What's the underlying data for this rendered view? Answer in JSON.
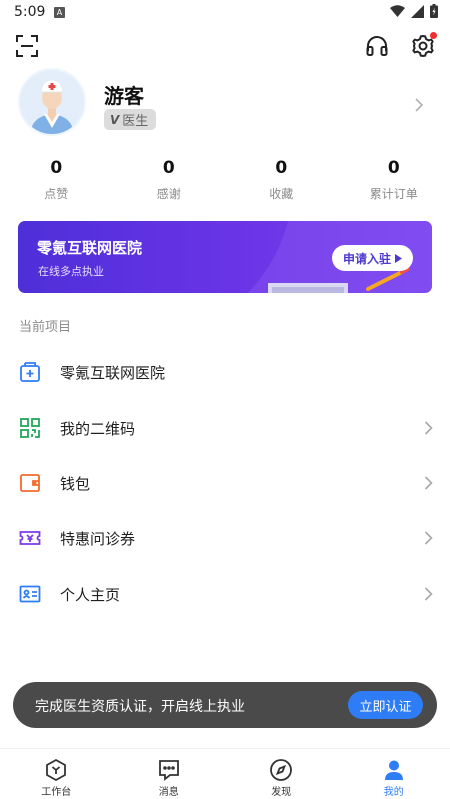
{
  "status_bar": {
    "time": "5:09",
    "notif_letter": "A"
  },
  "top_bar": {
    "icons": [
      "scan-icon",
      "headset-icon",
      "settings-icon"
    ],
    "settings_has_badge": true
  },
  "profile": {
    "name": "游客",
    "badge_mark": "V",
    "badge_text": "医生"
  },
  "stats": [
    {
      "value": "0",
      "label": "点赞"
    },
    {
      "value": "0",
      "label": "感谢"
    },
    {
      "value": "0",
      "label": "收藏"
    },
    {
      "value": "0",
      "label": "累计订单"
    }
  ],
  "banner": {
    "title": "零氪互联网医院",
    "subtitle": "在线多点执业",
    "button_label": "申请入驻"
  },
  "section": {
    "title": "当前项目"
  },
  "menu": [
    {
      "label": "零氪互联网医院",
      "icon": "hospital-icon",
      "chevron": false,
      "color": "#2f7df6"
    },
    {
      "label": "我的二维码",
      "icon": "qr-code-icon",
      "chevron": true,
      "color": "#22a85a"
    },
    {
      "label": "钱包",
      "icon": "wallet-icon",
      "chevron": true,
      "color": "#f36a2c"
    },
    {
      "label": "特惠问诊券",
      "icon": "coupon-icon",
      "chevron": true,
      "color": "#7b3be6"
    },
    {
      "label": "个人主页",
      "icon": "id-card-icon",
      "chevron": true,
      "color": "#2f7df6"
    }
  ],
  "toast": {
    "text": "完成医生资质认证，开启线上执业",
    "button_label": "立即认证"
  },
  "bottom_nav": [
    {
      "label": "工作台",
      "icon": "workbench-icon",
      "active": false
    },
    {
      "label": "消息",
      "icon": "message-icon",
      "active": false
    },
    {
      "label": "发现",
      "icon": "compass-icon",
      "active": false
    },
    {
      "label": "我的",
      "icon": "person-icon",
      "active": true
    }
  ],
  "colors": {
    "accent": "#2f7df6",
    "banner_start": "#4e2fd8",
    "banner_end": "#7a44ef",
    "toast_bg": "#4a4a4a",
    "badge_red": "#f22f2f"
  }
}
